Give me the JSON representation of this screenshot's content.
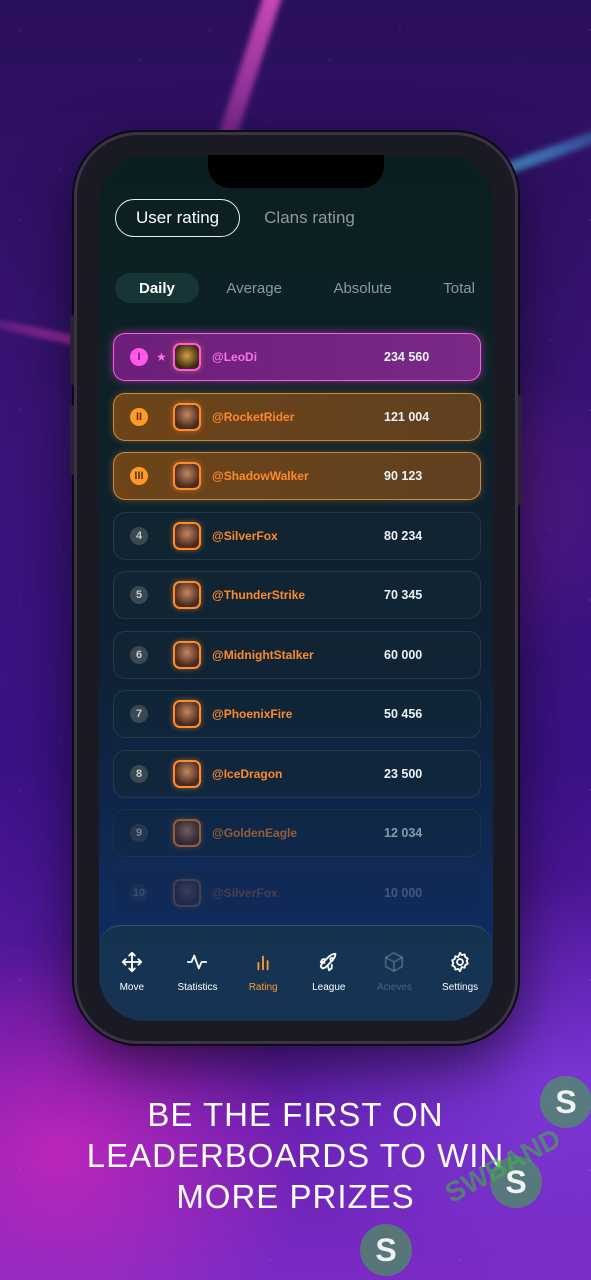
{
  "tabs_primary": [
    {
      "label": "User rating",
      "active": true
    },
    {
      "label": "Clans rating",
      "active": false
    }
  ],
  "tabs_period": [
    {
      "label": "Daily",
      "active": true
    },
    {
      "label": "Average",
      "active": false
    },
    {
      "label": "Absolute",
      "active": false
    },
    {
      "label": "Total",
      "active": false
    }
  ],
  "leaderboard": [
    {
      "rank": "I",
      "name": "@LeoDi",
      "score": "234 560",
      "starred": true
    },
    {
      "rank": "II",
      "name": "@RocketRider",
      "score": "121 004"
    },
    {
      "rank": "III",
      "name": "@ShadowWalker",
      "score": "90 123"
    },
    {
      "rank": "4",
      "name": "@SilverFox",
      "score": "80 234"
    },
    {
      "rank": "5",
      "name": "@ThunderStrike",
      "score": "70 345"
    },
    {
      "rank": "6",
      "name": "@MidnightStalker",
      "score": "60 000"
    },
    {
      "rank": "7",
      "name": "@PhoenixFire",
      "score": "50 456"
    },
    {
      "rank": "8",
      "name": "@IceDragon",
      "score": "23 500"
    },
    {
      "rank": "9",
      "name": "@GoldenEagle",
      "score": "12 034"
    },
    {
      "rank": "10",
      "name": "@SilverFox",
      "score": "10 000"
    }
  ],
  "nav": [
    {
      "label": "Move",
      "icon": "move-icon"
    },
    {
      "label": "Statistics",
      "icon": "pulse-icon"
    },
    {
      "label": "Rating",
      "icon": "bar-chart-icon",
      "active": true
    },
    {
      "label": "League",
      "icon": "rocket-icon"
    },
    {
      "label": "Acieves",
      "icon": "cube-icon",
      "disabled": true
    },
    {
      "label": "Settings",
      "icon": "gear-icon"
    }
  ],
  "headline": {
    "line1": "BE THE FIRST ON",
    "line2": "LEADERBOARDS TO WIN",
    "line3": "MORE PRIZES"
  },
  "watermark": {
    "text": "SWBAND"
  },
  "colors": {
    "accent_orange": "#ff8a2a",
    "accent_pink": "#ff58e6",
    "bg_purple": "#3b1286"
  }
}
